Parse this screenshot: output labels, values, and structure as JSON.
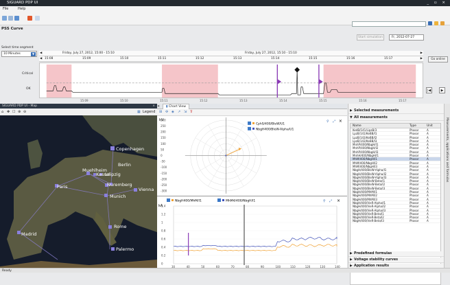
{
  "window": {
    "title": "SIGUARD PDP UI",
    "controls": "_ ▫ ×"
  },
  "menu": [
    {
      "label": "File"
    },
    {
      "label": "Help"
    }
  ],
  "header": {
    "section_title": "PSS Curve"
  },
  "sim": {
    "start_label": "Start simulation",
    "date_value": "Fr, 2012-07-27"
  },
  "timeline": {
    "segment_label": "Select time segment",
    "segment_value": "10 Minutes",
    "top_date": "Friday, July 27, 2012, 15:00 - 15:10",
    "top_date2": "Friday, July 27, 2012, 15:10 - 15:10",
    "top_ticks": [
      "15:08",
      "15:09",
      "15:10",
      "15:11",
      "15:12",
      "15:13",
      "15:14",
      "15:15",
      "15:16",
      "15:17"
    ],
    "go_online": "Go online",
    "bottom_ticks": [
      "15:09",
      "15:10",
      "15:11",
      "15:12",
      "15:13",
      "15:14",
      "15:15",
      "15:16",
      "15:17"
    ]
  },
  "overview": {
    "critical_label": "Critical",
    "ok_label": "OK",
    "prev_button": "|◀",
    "next_button": "▶"
  },
  "map": {
    "panel_title": "SIGUARD PDP UI - Map",
    "legend_label": "Legend",
    "cities": [
      "Copenhagen",
      "Berlin",
      "Muehlheim",
      "Leipzig",
      "Kassel",
      "Paris",
      "Nuremberg",
      "Munich",
      "Vienna",
      "Rome",
      "Madrid",
      "Palermo"
    ]
  },
  "chartview": {
    "tab_label": "Chart View",
    "polar_legend": [
      "CphS/400/BleW/U1",
      "NbgH400/BleW-Alpha/U1"
    ],
    "polar_unit": "kV",
    "line_legend": [
      "NbgH400/MhM/I1",
      "MhM4/400/NbgH/I1"
    ],
    "line_unit": "kA"
  },
  "rightpanel": {
    "selected_measurements": "Selected measurements",
    "all_measurements": "All measurements",
    "predefined_formulas": "Predefined formulas",
    "voltage_curves": "Voltage stability curves",
    "application_results": "Application results",
    "side_tab": "Measurements, applications and formulas",
    "table_headers": {
      "name": "Name",
      "type": "Type",
      "unit": "Unit"
    },
    "rows": [
      {
        "name": "KedB/141/LipzB/3",
        "type": "Phasor",
        "unit": "A"
      },
      {
        "name": "LpzB/141/KeBB/I1",
        "type": "Phasor",
        "unit": "A"
      },
      {
        "name": "LpzB/143/KeBB/I2",
        "type": "Phasor",
        "unit": "A"
      },
      {
        "name": "LpzB/143/KeBB/I3",
        "type": "Phasor",
        "unit": "A"
      },
      {
        "name": "MnhP/400/NbgH/I1",
        "type": "Phasor",
        "unit": "A"
      },
      {
        "name": "MnhP/400/NbgH/I2",
        "type": "Phasor",
        "unit": "A"
      },
      {
        "name": "MnhP/400/NbgH/I3",
        "type": "Phasor",
        "unit": "A"
      },
      {
        "name": "MnhH/400/NbgH/I1",
        "type": "Phasor",
        "unit": "A"
      },
      {
        "name": "MhM/400/NbgH/I1",
        "type": "Phasor",
        "unit": "A"
      },
      {
        "name": "MhM/400/NbgH/I2",
        "type": "Phasor",
        "unit": "A"
      },
      {
        "name": "MhM/400/NbgH/I3",
        "type": "Phasor",
        "unit": "A"
      },
      {
        "name": "NbgH/400/BleW-Alpha/I1",
        "type": "Phasor",
        "unit": "A"
      },
      {
        "name": "NbgH/400/BleW-Alpha/I2",
        "type": "Phasor",
        "unit": "A"
      },
      {
        "name": "NbgH/400/BleW-Alpha/I3",
        "type": "Phasor",
        "unit": "A"
      },
      {
        "name": "NbgH/400/BleW-Beta/I1",
        "type": "Phasor",
        "unit": "A"
      },
      {
        "name": "NbgH/400/BleW-Beta/I2",
        "type": "Phasor",
        "unit": "A"
      },
      {
        "name": "NbgH/400/BleW-Beta/I3",
        "type": "Phasor",
        "unit": "A"
      },
      {
        "name": "NbgH/400/MhM/I1",
        "type": "Phasor",
        "unit": "A"
      },
      {
        "name": "NbgH/400/MhM/I2",
        "type": "Phasor",
        "unit": "A"
      },
      {
        "name": "NbgH/400/MhM/I3",
        "type": "Phasor",
        "unit": "A"
      },
      {
        "name": "NbgH/400/VieR-Alpha/I1",
        "type": "Phasor",
        "unit": "A"
      },
      {
        "name": "NbgH/400/VieR-Alpha/I2",
        "type": "Phasor",
        "unit": "A"
      },
      {
        "name": "NbgH/400/VieR-Alpha/I3",
        "type": "Phasor",
        "unit": "A"
      },
      {
        "name": "NbgH/400/VieR-Beta/I1",
        "type": "Phasor",
        "unit": "A"
      },
      {
        "name": "NbgH/400/VieR-Beta/I2",
        "type": "Phasor",
        "unit": "A"
      },
      {
        "name": "NbgH/400/VieR-Beta/I3",
        "type": "Phasor",
        "unit": "A"
      }
    ],
    "selected_row_index": 8
  },
  "status": {
    "text": "Ready"
  },
  "colors": {
    "accent": "#2f6fb5",
    "critical_band": "#f5c5c9",
    "series_orange": "#f0a030",
    "series_blue": "#3f4fb8",
    "marker_purple": "#8a3ab5"
  },
  "chart_data": [
    {
      "type": "scatter",
      "title": "",
      "unit": "kV",
      "yticks": [
        300,
        250,
        200,
        150,
        100,
        50,
        0,
        -50,
        -100,
        -150,
        -200,
        -250,
        -300
      ],
      "series": [
        {
          "name": "CphS/400/BleW/U1",
          "x": [
            0
          ],
          "y": [
            0
          ]
        },
        {
          "name": "NbgH400/BleW-Alpha/U1",
          "x": [
            0,
            130
          ],
          "y": [
            0,
            60
          ]
        }
      ]
    },
    {
      "type": "line",
      "title": "",
      "unit": "kA",
      "ylim": [
        0,
        1.4
      ],
      "yticks": [
        1.4,
        1.2,
        1.0,
        0.8,
        0.6,
        0.4,
        0.2,
        0
      ],
      "x": [
        30,
        40,
        50,
        60,
        70,
        80,
        90,
        100,
        110,
        120,
        130,
        140
      ],
      "series": [
        {
          "name": "NbgH400/MhM/I1",
          "values": [
            0.42,
            0.42,
            0.44,
            0.42,
            0.42,
            0.42,
            0.42,
            0.55,
            0.6,
            0.62,
            0.6,
            0.62
          ]
        },
        {
          "name": "MhM4/400/NbgH/I1",
          "values": [
            0.32,
            0.32,
            0.36,
            0.32,
            0.32,
            0.32,
            0.32,
            0.42,
            0.45,
            0.44,
            0.45,
            0.44
          ]
        }
      ]
    }
  ]
}
